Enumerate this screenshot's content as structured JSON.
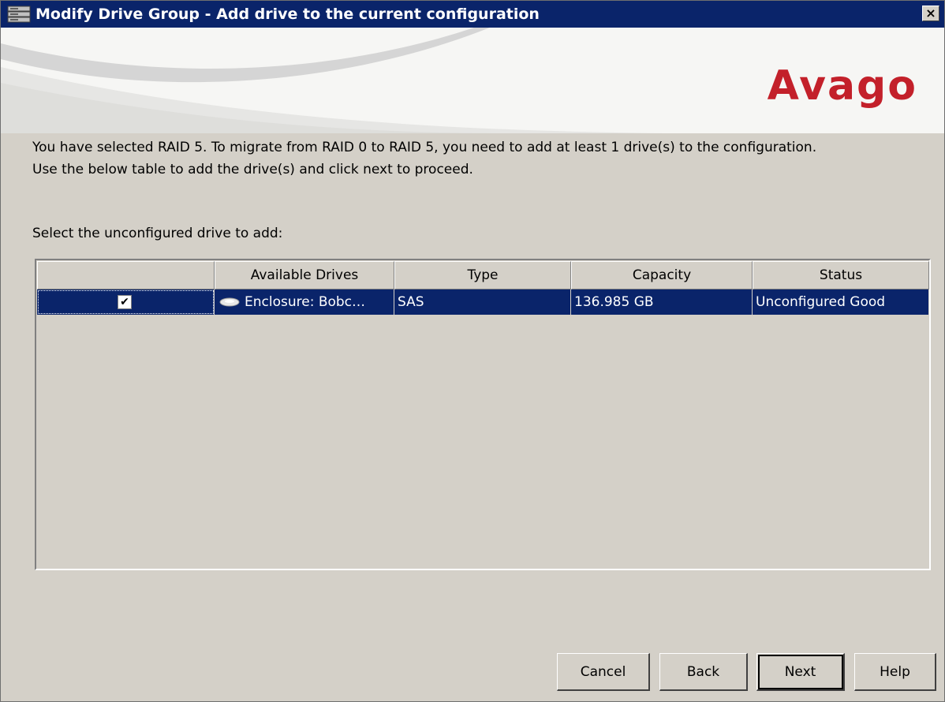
{
  "window": {
    "title": "Modify Drive Group - Add drive to the current configuration",
    "close_label": "×"
  },
  "banner": {
    "logo_text": "Avago"
  },
  "message": {
    "line1": "You have selected RAID 5. To migrate from RAID 0 to RAID 5, you need to add at least 1 drive(s) to the configuration.",
    "line2": "Use the below table to add the drive(s) and click next to proceed."
  },
  "select_label": "Select the unconfigured drive to add:",
  "table": {
    "headers": [
      "",
      "Available Drives",
      "Type",
      "Capacity",
      "Status"
    ],
    "rows": [
      {
        "checked": true,
        "check_glyph": "✔",
        "drive": "Enclosure: Bobc…",
        "type": "SAS",
        "capacity": "136.985 GB",
        "status": "Unconfigured Good",
        "drive_icon": "disk-drive-icon"
      }
    ]
  },
  "buttons": {
    "cancel": "Cancel",
    "back": "Back",
    "next": "Next",
    "help": "Help"
  },
  "colors": {
    "title_bar": "#0a246a",
    "selection": "#0a246a",
    "logo": "#c3202a",
    "dialog_bg": "#d4d0c8"
  }
}
